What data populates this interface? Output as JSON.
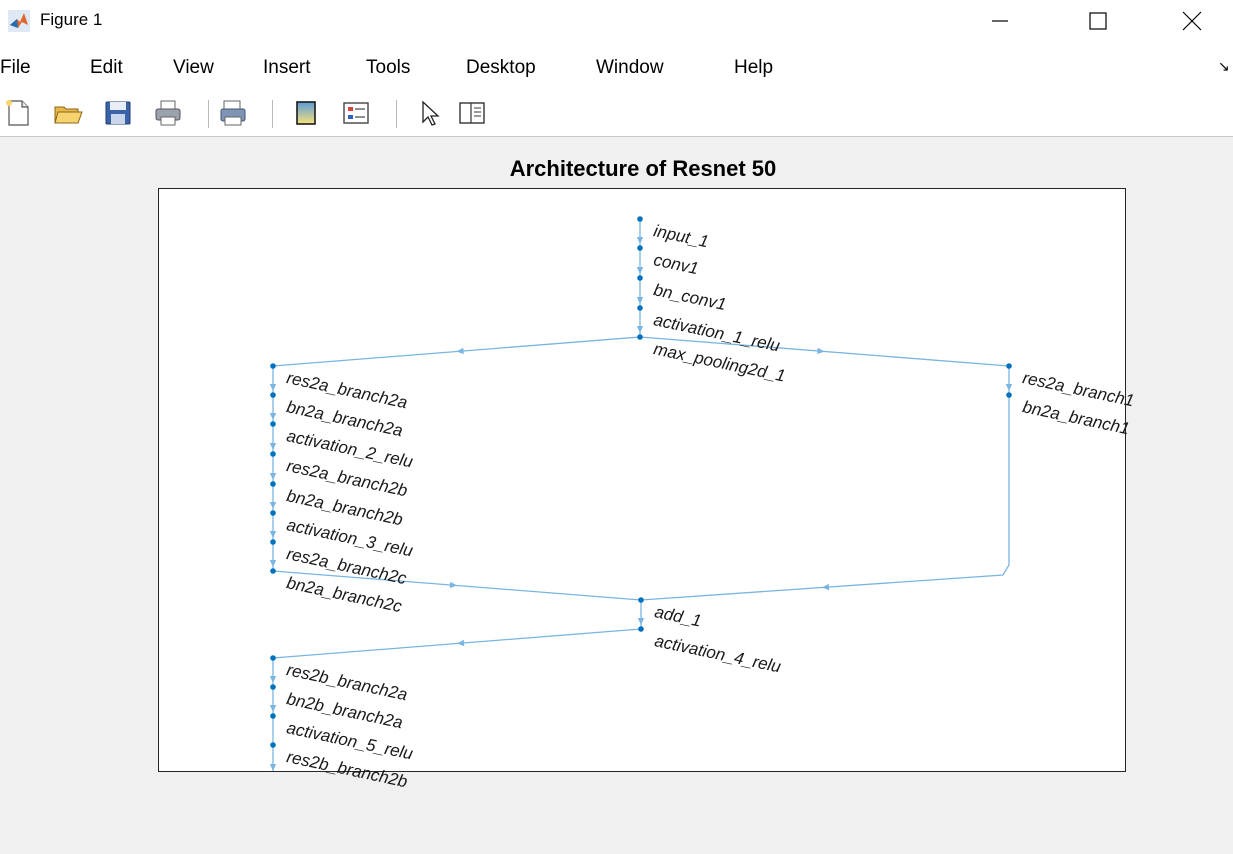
{
  "window": {
    "title": "Figure 1"
  },
  "menu": [
    "File",
    "Edit",
    "View",
    "Insert",
    "Tools",
    "Desktop",
    "Window",
    "Help"
  ],
  "toolbar": [
    "new-figure-icon",
    "open-file-icon",
    "save-icon",
    "print-icon",
    "print-preview-icon",
    "colorbar-icon",
    "legend-icon",
    "pointer-icon",
    "property-inspector-icon"
  ],
  "colors": {
    "edge": "#79b5e0",
    "node": "#0072bd",
    "axes": "#262626",
    "background": "#f0f0f0"
  },
  "chart_data": {
    "type": "layered-graph",
    "title": "Architecture of Resnet 50",
    "nodes": [
      "input_1",
      "conv1",
      "bn_conv1",
      "activation_1_relu",
      "max_pooling2d_1",
      "res2a_branch2a",
      "bn2a_branch2a",
      "activation_2_relu",
      "res2a_branch2b",
      "bn2a_branch2b",
      "activation_3_relu",
      "res2a_branch2c",
      "bn2a_branch2c",
      "res2a_branch1",
      "bn2a_branch1",
      "add_1",
      "activation_4_relu",
      "res2b_branch2a",
      "bn2b_branch2a",
      "activation_5_relu",
      "res2b_branch2b"
    ],
    "edges": [
      [
        "input_1",
        "conv1"
      ],
      [
        "conv1",
        "bn_conv1"
      ],
      [
        "bn_conv1",
        "activation_1_relu"
      ],
      [
        "activation_1_relu",
        "max_pooling2d_1"
      ],
      [
        "max_pooling2d_1",
        "res2a_branch2a"
      ],
      [
        "max_pooling2d_1",
        "res2a_branch1"
      ],
      [
        "res2a_branch2a",
        "bn2a_branch2a"
      ],
      [
        "bn2a_branch2a",
        "activation_2_relu"
      ],
      [
        "activation_2_relu",
        "res2a_branch2b"
      ],
      [
        "res2a_branch2b",
        "bn2a_branch2b"
      ],
      [
        "bn2a_branch2b",
        "activation_3_relu"
      ],
      [
        "activation_3_relu",
        "res2a_branch2c"
      ],
      [
        "res2a_branch2c",
        "bn2a_branch2c"
      ],
      [
        "res2a_branch1",
        "bn2a_branch1"
      ],
      [
        "bn2a_branch2c",
        "add_1"
      ],
      [
        "bn2a_branch1",
        "add_1"
      ],
      [
        "add_1",
        "activation_4_relu"
      ],
      [
        "activation_4_relu",
        "res2b_branch2a"
      ],
      [
        "res2b_branch2a",
        "bn2b_branch2a"
      ],
      [
        "bn2b_branch2a",
        "activation_5_relu"
      ],
      [
        "activation_5_relu",
        "res2b_branch2b"
      ]
    ],
    "grid": false,
    "ticks": false,
    "label_rotation_deg": -12
  }
}
